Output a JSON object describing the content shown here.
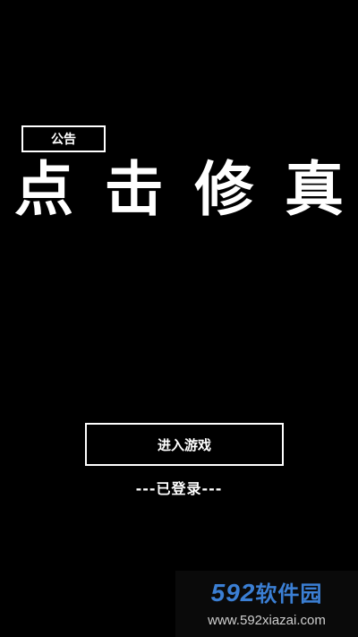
{
  "notice": {
    "label": "公告"
  },
  "title": {
    "chars": [
      "点",
      "击",
      "修",
      "真"
    ]
  },
  "enter": {
    "label": "进入游戏"
  },
  "login": {
    "status": "---已登录---"
  },
  "watermark": {
    "logo_num": "592",
    "logo_text": "软件园",
    "url": "www.592xiazai.com"
  },
  "colors": {
    "background": "#000000",
    "foreground": "#ffffff",
    "watermark_accent": "#3b7fd4"
  }
}
